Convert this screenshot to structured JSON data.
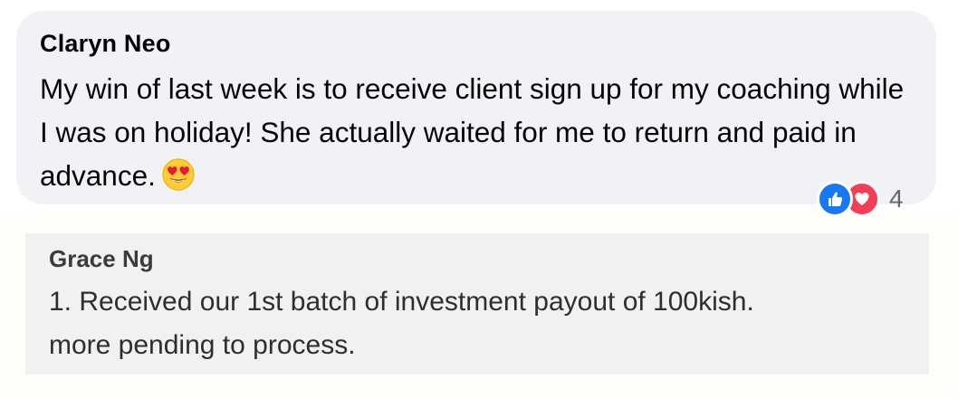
{
  "comment1": {
    "author": "Claryn Neo",
    "text": "My win of last week is to receive client sign up for my coaching while I was on holiday! She actually waited for me to return and paid in advance.",
    "emoji": "heart-eyes-emoji"
  },
  "reactions": {
    "icons": [
      "like-icon",
      "love-icon"
    ],
    "count": "4"
  },
  "comment2": {
    "author": "Grace Ng",
    "line1": "1. Received our 1st batch of investment payout of 100kish.",
    "line2": "more pending to process."
  },
  "colors": {
    "bubble": "#f0f2f5",
    "like": "#1877f2",
    "love": "#f33e58",
    "secondary_text": "#65676b"
  }
}
